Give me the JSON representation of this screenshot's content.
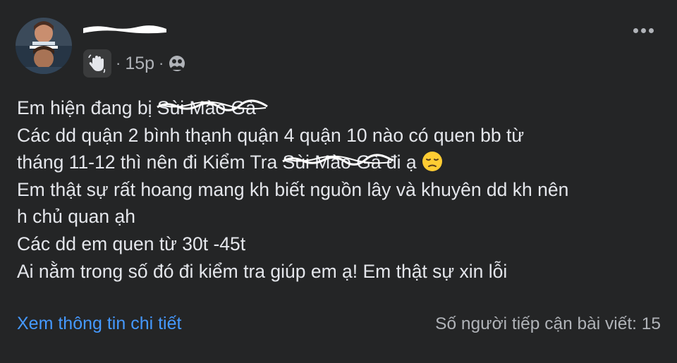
{
  "header": {
    "timestamp": "15p",
    "separator": "·",
    "icons": {
      "badge": "wave-hand-icon",
      "privacy": "friends-icon",
      "more": "more-options-icon"
    }
  },
  "post": {
    "lines": [
      {
        "before": "Em hiện đang bị ",
        "redacted": "Sùi Mào Gà",
        "after": "",
        "emoji": ""
      },
      {
        "before": "Các dd quận 2 bình thạnh quận 4 quận 10 nào có quen bb từ",
        "redacted": "",
        "after": "",
        "emoji": ""
      },
      {
        "before": "tháng 11-12 thì nên đi Kiểm Tra ",
        "redacted": "Sùi Mào Gà",
        "after": " đi ạ ",
        "emoji": "pensive-face"
      },
      {
        "before": "Em thật sự rất hoang mang kh biết nguồn lây và khuyên dd kh nên",
        "redacted": "",
        "after": "",
        "emoji": ""
      },
      {
        "before": "h chủ quan ạh",
        "redacted": "",
        "after": "",
        "emoji": ""
      },
      {
        "before": "Các dd em quen từ 30t -45t",
        "redacted": "",
        "after": "",
        "emoji": ""
      },
      {
        "before": "Ai nằm trong số đó đi kiểm tra giúp em ạ! Em thật sự xin lỗi",
        "redacted": "",
        "after": "",
        "emoji": ""
      }
    ]
  },
  "footer": {
    "details_link": "Xem thông tin chi tiết",
    "reach_text": "Số người tiếp cận bài viết: 15"
  },
  "colors": {
    "background": "#242526",
    "text": "#e4e6eb",
    "secondary": "#b0b3b8",
    "link": "#4599ff"
  }
}
